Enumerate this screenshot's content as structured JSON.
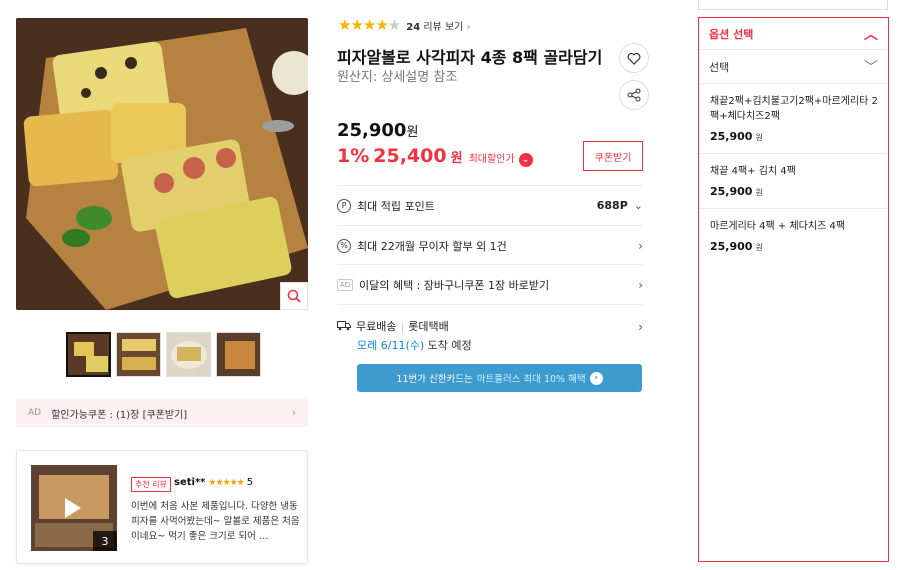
{
  "rating": {
    "stars_filled": 4,
    "stars_total": 5,
    "review_count": "24",
    "review_link": "리뷰 보기"
  },
  "product": {
    "title": "피자알볼로 사각피자 4종 8팩 골라담기",
    "origin": "원산지: 상세설명 참조",
    "price": "25,900",
    "price_unit": "원",
    "discount_rate": "1%",
    "sale_price": "25,400",
    "sale_unit": "원",
    "max_discount_label": "최대할인가",
    "coupon_button": "쿠폰받기"
  },
  "info_rows": {
    "points": {
      "label": "최대 적립 포인트",
      "value": "688P"
    },
    "installment": {
      "label": "최대 22개월 무이자 할부 외 1건"
    },
    "benefit": {
      "ad": "AD",
      "label": "이달의 혜택 : 장바구니쿠폰 1장 바로받기"
    },
    "shipping": {
      "free": "무료배송",
      "carrier": "롯데택배",
      "date_hl": "모레 6/11(수)",
      "date_rest": "도착 예정"
    }
  },
  "card_banner": {
    "text1": "11번가 신한카드는",
    "text2": "마트플러스 최대 10% 혜택"
  },
  "left": {
    "coupon_bar": {
      "ad": "AD",
      "text": "할인가능쿠폰 : (1)장 [쿠폰받기]"
    },
    "review": {
      "badge": "추천 리뷰",
      "user": "seti**",
      "score": "5",
      "text": "이번에 처음 사본 제품입니다. 다양한 냉동피자를 사먹어봤는데~ 알볼로 제품은 처음이네요~ 먹기 좋은 크기로 되어 …",
      "image_count": "3"
    }
  },
  "options": {
    "header": "옵션 선택",
    "select_label": "선택",
    "items": [
      {
        "name": "채끝2팩+김치불고기2팩+마르게리타 2팩+체다치즈2팩",
        "price": "25,900",
        "unit": "원"
      },
      {
        "name": "채끝 4팩+ 김치 4팩",
        "price": "25,900",
        "unit": "원"
      },
      {
        "name": "마르게리타 4팩 + 체다치즈 4팩",
        "price": "25,900",
        "unit": "원"
      }
    ]
  },
  "colors": {
    "accent": "#f43142",
    "banner": "#3e9bcf",
    "star": "#f5b400",
    "link_blue": "#0b83e6"
  },
  "icons": [
    "heart-icon",
    "share-icon",
    "zoom-icon",
    "point-icon",
    "card-icon",
    "truck-icon",
    "chevron-right-icon",
    "chevron-down-icon",
    "chevron-up-icon",
    "play-icon"
  ]
}
